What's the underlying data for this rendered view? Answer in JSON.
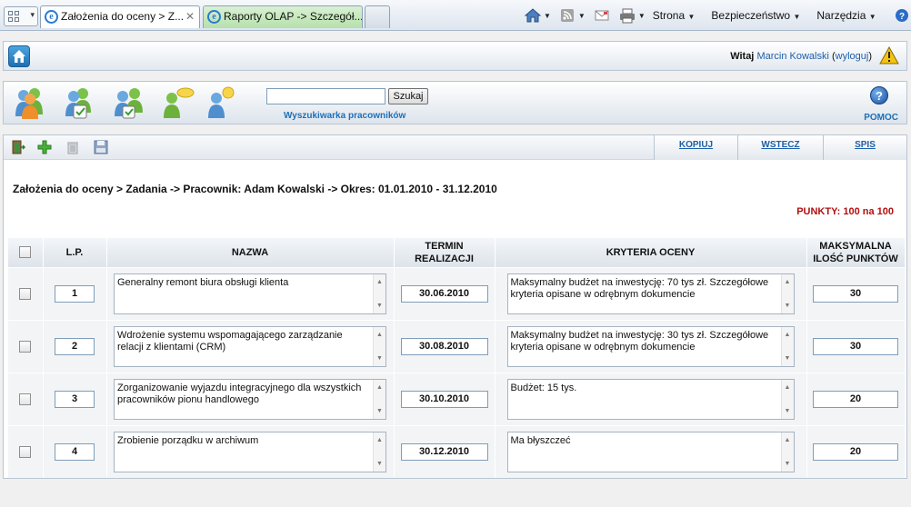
{
  "browser": {
    "tabs": [
      {
        "title": "Założenia do oceny > Z..."
      },
      {
        "title": "Raporty OLAP -> Szczegół..."
      }
    ],
    "menu": {
      "page": "Strona",
      "security": "Bezpieczeństwo",
      "tools": "Narzędzia"
    }
  },
  "header": {
    "greeting": "Witaj",
    "user_name": "Marcin Kowalski",
    "logout": "wyloguj"
  },
  "toolbar": {
    "search_value": "",
    "search_button": "Szukaj",
    "search_caption": "Wyszukiwarka pracowników",
    "help_label": "POMOC"
  },
  "actions": {
    "copy": "KOPIUJ",
    "back": "WSTECZ",
    "list": "SPIS"
  },
  "page": {
    "breadcrumb": "Założenia do oceny > Zadania -> Pracownik: Adam Kowalski -> Okres: 01.01.2010 - 31.12.2010",
    "points": "PUNKTY: 100 na 100"
  },
  "table": {
    "headers": {
      "lp": "L.P.",
      "name": "NAZWA",
      "deadline_1": "TERMIN",
      "deadline_2": "REALIZACJI",
      "criteria": "KRYTERIA OCENY",
      "max_1": "MAKSYMALNA",
      "max_2": "ILOŚĆ PUNKTÓW"
    },
    "rows": [
      {
        "lp": "1",
        "name": "Generalny remont biura obsługi klienta",
        "deadline": "30.06.2010",
        "criteria": "Maksymalny budżet na inwestycję: 70 tys zł. Szczegółowe kryteria opisane w odrębnym dokumencie",
        "points": "30"
      },
      {
        "lp": "2",
        "name": "Wdrożenie systemu wspomagającego zarządzanie relacji z klientami (CRM)",
        "deadline": "30.08.2010",
        "criteria": "Maksymalny budżet na inwestycję: 30 tys zł. Szczegółowe kryteria opisane w odrębnym dokumencie",
        "points": "30"
      },
      {
        "lp": "3",
        "name": "Zorganizowanie wyjazdu integracyjnego dla wszystkich pracowników pionu handlowego",
        "deadline": "30.10.2010",
        "criteria": "Budżet: 15 tys.",
        "points": "20"
      },
      {
        "lp": "4",
        "name": "Zrobienie porządku w archiwum",
        "deadline": "30.12.2010",
        "criteria": "Ma błyszczeć",
        "points": "20"
      }
    ]
  }
}
